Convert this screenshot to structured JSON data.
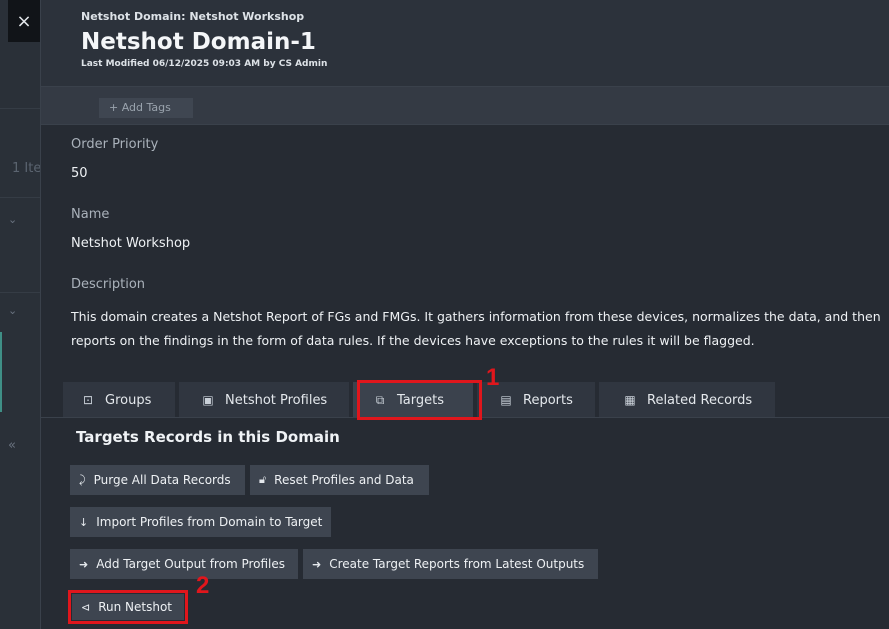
{
  "background": {
    "partial_text": "1 Ite"
  },
  "close_icon": "×",
  "header": {
    "breadcrumb": "Netshot Domain: Netshot Workshop",
    "title": "Netshot Domain-1",
    "last_modified": "Last Modified 06/12/2025 09:03 AM by CS Admin"
  },
  "tags": {
    "add_label": "+ Add Tags"
  },
  "fields": {
    "order_priority_label": "Order Priority",
    "order_priority_value": "50",
    "name_label": "Name",
    "name_value": "Netshot Workshop",
    "description_label": "Description",
    "description_value": "This domain creates a Netshot Report of FGs and FMGs. It gathers information from these devices, normalizes the data, and then reports on the findings in the form of data rules. If the devices have exceptions to the rules it will be flagged."
  },
  "tabs": [
    {
      "label": "Groups",
      "icon": "groups-icon"
    },
    {
      "label": "Netshot Profiles",
      "icon": "profiles-icon"
    },
    {
      "label": "Targets",
      "icon": "targets-icon",
      "active": true
    },
    {
      "label": "Reports",
      "icon": "reports-icon"
    },
    {
      "label": "Related Records",
      "icon": "related-records-icon"
    }
  ],
  "panel": {
    "title": "Targets Records in this Domain",
    "buttons": {
      "purge": "Purge All Data Records",
      "reset": "Reset Profiles and Data",
      "import": "Import Profiles from Domain to Target",
      "add_output": "Add Target Output from Profiles",
      "create_reports": "Create Target Reports from Latest Outputs",
      "run": "Run Netshot"
    }
  },
  "annotations": {
    "one": "1",
    "two": "2"
  },
  "colors": {
    "highlight": "#e0161c",
    "background": "#262b33"
  }
}
